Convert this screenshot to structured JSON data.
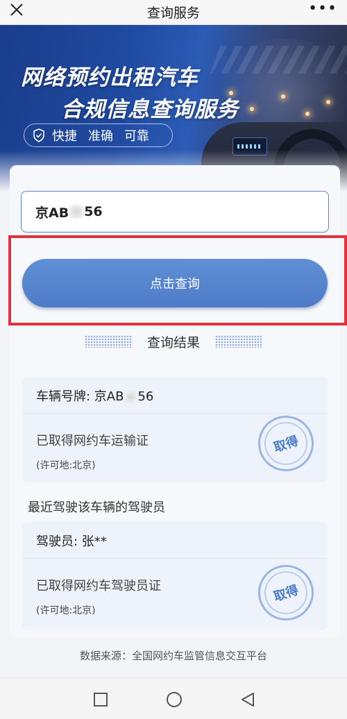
{
  "topbar": {
    "close_icon": "close-icon",
    "title": "查询服务",
    "more_icon": "more-icon",
    "more_glyph": "•••"
  },
  "banner": {
    "slogan_line1": "网络预约出租汽车",
    "slogan_line2": "合规信息查询服务",
    "tags": [
      "快捷",
      "准确",
      "可靠"
    ],
    "badge_icon": "shield-check-icon"
  },
  "search": {
    "plate_prefix": "京AB",
    "plate_suffix": "56",
    "button_label": "点击查询"
  },
  "results": {
    "title": "查询结果",
    "vehicle": {
      "label": "车辆号牌: ",
      "plate_prefix": "京AB",
      "plate_suffix": "56",
      "cert_text": "已取得网约车运输证",
      "place_text": "(许可地:北京)",
      "stamp_text": "取得"
    },
    "drivers_title": "最近驾驶该车辆的驾驶员",
    "driver": {
      "name_text": "驾驶员: 张**",
      "cert_text": "已取得网约车驾驶员证",
      "place_text": "(许可地:北京)",
      "stamp_text": "取得"
    }
  },
  "footer": {
    "source_text": "数据来源：全国网约车监管信息交互平台"
  },
  "navbar": {
    "icons": [
      "square-recent-icon",
      "circle-home-icon",
      "triangle-back-icon"
    ]
  },
  "colors": {
    "accent": "#4f7bc6",
    "highlight_border": "#e2323b",
    "banner_blue": "#1f4aa0"
  }
}
